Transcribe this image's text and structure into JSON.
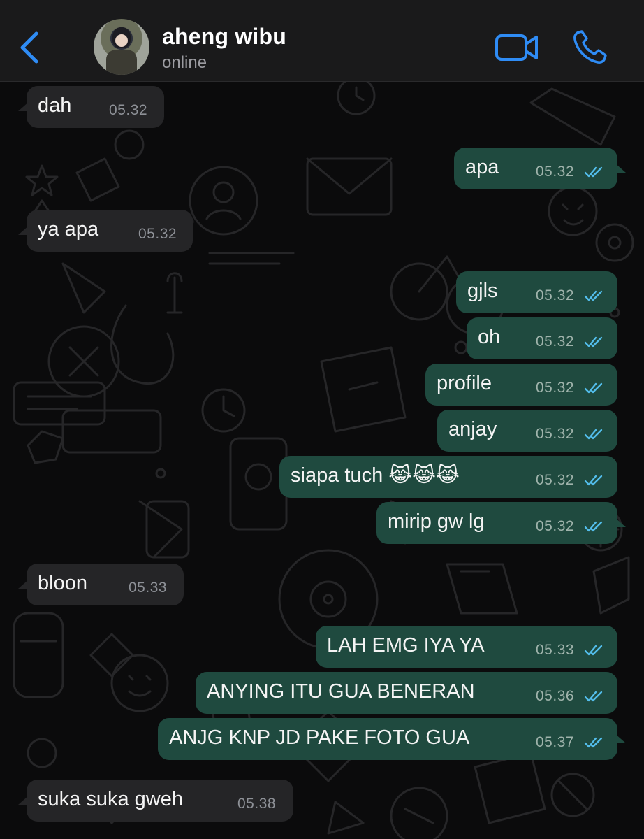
{
  "header": {
    "contact_name": "aheng wibu",
    "status": "online",
    "icons": {
      "back": "chevron-left-icon",
      "video": "video-camera-icon",
      "call": "phone-icon"
    }
  },
  "colors": {
    "accent": "#2f8cf5",
    "incoming_bubble": "#252527",
    "outgoing_bubble": "#1f4a3f",
    "read_ticks": "#53bdeb"
  },
  "messages": [
    {
      "direction": "in",
      "text": "dah",
      "time": "05.32"
    },
    {
      "direction": "out",
      "text": "apa",
      "time": "05.32",
      "status": "read"
    },
    {
      "direction": "in",
      "text": "ya apa",
      "time": "05.32"
    },
    {
      "direction": "out",
      "text": "gjls",
      "time": "05.32",
      "status": "read"
    },
    {
      "direction": "out",
      "text": "oh",
      "time": "05.32",
      "status": "read"
    },
    {
      "direction": "out",
      "text": "profile",
      "time": "05.32",
      "status": "read"
    },
    {
      "direction": "out",
      "text": "anjay",
      "time": "05.32",
      "status": "read"
    },
    {
      "direction": "out",
      "text": "siapa tuch 😹😹😹",
      "time": "05.32",
      "status": "read"
    },
    {
      "direction": "out",
      "text": "mirip gw lg",
      "time": "05.32",
      "status": "read"
    },
    {
      "direction": "in",
      "text": "bloon",
      "time": "05.33"
    },
    {
      "direction": "out",
      "text": "LAH EMG IYA YA",
      "time": "05.33",
      "status": "read"
    },
    {
      "direction": "out",
      "text": "ANYING ITU GUA BENERAN",
      "time": "05.36",
      "status": "read"
    },
    {
      "direction": "out",
      "text": "ANJG KNP JD PAKE FOTO GUA",
      "time": "05.37",
      "status": "read"
    },
    {
      "direction": "in",
      "text": "suka suka gweh",
      "time": "05.38"
    }
  ]
}
